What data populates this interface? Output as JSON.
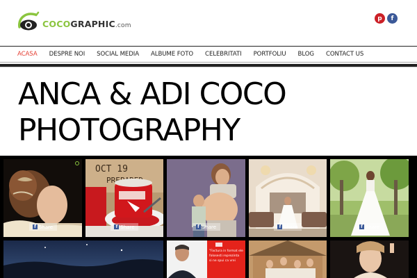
{
  "header": {
    "logo": {
      "coco": "COCO",
      "graphic": "GRAPHIC",
      "suffix": ".com"
    },
    "social": {
      "pinterest_glyph": "p",
      "facebook_glyph": "f"
    }
  },
  "nav": {
    "items": [
      {
        "label": "ACASA",
        "active": true
      },
      {
        "label": "DESPRE NOI",
        "active": false
      },
      {
        "label": "SOCIAL MEDIA",
        "active": false
      },
      {
        "label": "ALBUME FOTO",
        "active": false
      },
      {
        "label": "CELEBRITATI",
        "active": false
      },
      {
        "label": "PORTFOLIU",
        "active": false
      },
      {
        "label": "BLOG",
        "active": false
      },
      {
        "label": "CONTACT US",
        "active": false
      }
    ]
  },
  "page": {
    "title_line1": "ANCA & ADI COCO",
    "title_line2": "PHOTOGRAPHY"
  },
  "gallery": {
    "share_label": "Share",
    "tiles": [
      {
        "name": "photo-bride-hairstyle"
      },
      {
        "name": "photo-red-coffee-cup"
      },
      {
        "name": "photo-pregnant-couple"
      },
      {
        "name": "photo-bride-interior"
      },
      {
        "name": "photo-bride-park"
      },
      {
        "name": "photo-night-landscape"
      },
      {
        "name": "photo-man-portrait"
      },
      {
        "name": "photo-wedding-group"
      },
      {
        "name": "photo-woman-portrait"
      }
    ],
    "ad_text": [
      "\"Factura in format ele",
      "folosesti reprezinta",
      "si ne spui ca vrei"
    ]
  },
  "colors": {
    "accent_green": "#8bc53f",
    "active_nav": "#e33b2f",
    "pinterest": "#cb2027",
    "facebook": "#3b5998"
  }
}
